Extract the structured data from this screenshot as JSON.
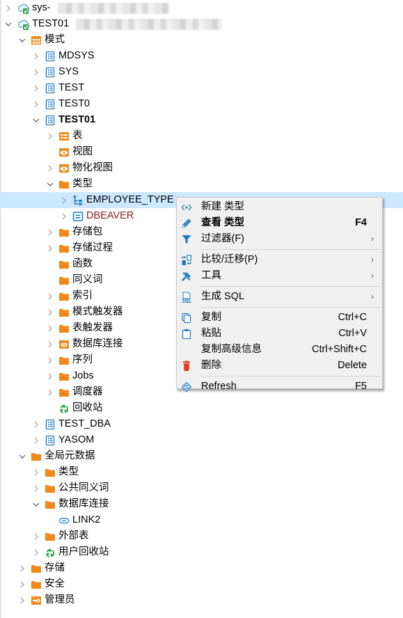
{
  "tree": {
    "rows": [
      {
        "label": "sys",
        "suffix": " -",
        "redacted": true,
        "indent": 0,
        "twisty": "collapsed",
        "icon": "db-connection-icon"
      },
      {
        "label": "TEST01",
        "redacted": true,
        "indent": 0,
        "twisty": "expanded",
        "icon": "db-connection-icon"
      },
      {
        "label": "模式",
        "indent": 1,
        "twisty": "expanded",
        "icon": "schema-folder-icon"
      },
      {
        "label": "MDSYS",
        "indent": 2,
        "twisty": "collapsed",
        "icon": "schema-icon"
      },
      {
        "label": "SYS",
        "indent": 2,
        "twisty": "collapsed",
        "icon": "schema-icon"
      },
      {
        "label": "TEST",
        "indent": 2,
        "twisty": "collapsed",
        "icon": "schema-icon"
      },
      {
        "label": "TEST0",
        "indent": 2,
        "twisty": "collapsed",
        "icon": "schema-icon"
      },
      {
        "label": "TEST01",
        "indent": 2,
        "twisty": "expanded",
        "icon": "schema-icon",
        "bold": true
      },
      {
        "label": "表",
        "indent": 3,
        "twisty": "collapsed",
        "icon": "table-folder-icon"
      },
      {
        "label": "视图",
        "indent": 3,
        "twisty": "none",
        "icon": "view-folder-icon"
      },
      {
        "label": "物化视图",
        "indent": 3,
        "twisty": "collapsed",
        "icon": "view-folder-icon"
      },
      {
        "label": "类型",
        "indent": 3,
        "twisty": "expanded",
        "icon": "folder-icon"
      },
      {
        "label": "EMPLOYEE_TYPE",
        "indent": 4,
        "twisty": "collapsed",
        "icon": "type-icon",
        "selected": true
      },
      {
        "label": "DBEAVER",
        "indent": 4,
        "twisty": "collapsed",
        "icon": "type-invalid-icon",
        "red": true
      },
      {
        "label": "存储包",
        "indent": 3,
        "twisty": "collapsed",
        "icon": "folder-icon"
      },
      {
        "label": "存储过程",
        "indent": 3,
        "twisty": "collapsed",
        "icon": "folder-icon"
      },
      {
        "label": "函数",
        "indent": 3,
        "twisty": "none",
        "icon": "folder-icon"
      },
      {
        "label": "同义词",
        "indent": 3,
        "twisty": "none",
        "icon": "folder-icon"
      },
      {
        "label": "索引",
        "indent": 3,
        "twisty": "collapsed",
        "icon": "folder-icon"
      },
      {
        "label": "模式触发器",
        "indent": 3,
        "twisty": "collapsed",
        "icon": "folder-icon"
      },
      {
        "label": "表触发器",
        "indent": 3,
        "twisty": "collapsed",
        "icon": "folder-icon"
      },
      {
        "label": "数据库连接",
        "indent": 3,
        "twisty": "collapsed",
        "icon": "link-folder-icon"
      },
      {
        "label": "序列",
        "indent": 3,
        "twisty": "collapsed",
        "icon": "folder-icon"
      },
      {
        "label": "Jobs",
        "indent": 3,
        "twisty": "collapsed",
        "icon": "folder-icon"
      },
      {
        "label": "调度器",
        "indent": 3,
        "twisty": "collapsed",
        "icon": "folder-icon"
      },
      {
        "label": "回收站",
        "indent": 3,
        "twisty": "none",
        "icon": "recycle-icon"
      },
      {
        "label": "TEST_DBA",
        "indent": 2,
        "twisty": "collapsed",
        "icon": "schema-icon"
      },
      {
        "label": "YASOM",
        "indent": 2,
        "twisty": "collapsed",
        "icon": "schema-icon"
      },
      {
        "label": "全局元数据",
        "indent": 1,
        "twisty": "expanded",
        "icon": "folder-icon"
      },
      {
        "label": "类型",
        "indent": 2,
        "twisty": "collapsed",
        "icon": "folder-icon"
      },
      {
        "label": "公共同义词",
        "indent": 2,
        "twisty": "collapsed",
        "icon": "folder-icon"
      },
      {
        "label": "数据库连接",
        "indent": 2,
        "twisty": "expanded",
        "icon": "folder-icon"
      },
      {
        "label": "LINK2",
        "indent": 3,
        "twisty": "none",
        "icon": "link-icon"
      },
      {
        "label": "外部表",
        "indent": 2,
        "twisty": "collapsed",
        "icon": "folder-icon"
      },
      {
        "label": "用户回收站",
        "indent": 2,
        "twisty": "collapsed",
        "icon": "recycle-icon"
      },
      {
        "label": "存储",
        "indent": 1,
        "twisty": "collapsed",
        "icon": "folder-icon"
      },
      {
        "label": "安全",
        "indent": 1,
        "twisty": "collapsed",
        "icon": "folder-icon"
      },
      {
        "label": "管理员",
        "indent": 1,
        "twisty": "collapsed",
        "icon": "admin-folder-icon"
      }
    ]
  },
  "context_menu": {
    "items": [
      {
        "type": "item",
        "label": "新建 类型",
        "icon": "new-icon",
        "accel": "",
        "submenu": false
      },
      {
        "type": "item",
        "label": "查看 类型",
        "icon": "edit-pencil-icon",
        "accel": "F4",
        "bold": true,
        "submenu": false
      },
      {
        "type": "item",
        "label": "过滤器(F)",
        "icon": "filter-icon",
        "accel": "",
        "submenu": true
      },
      {
        "type": "separator"
      },
      {
        "type": "item",
        "label": "比较/迁移(P)",
        "icon": "compare-icon",
        "accel": "",
        "submenu": true
      },
      {
        "type": "item",
        "label": "工具",
        "icon": "tools-icon",
        "accel": "",
        "submenu": true
      },
      {
        "type": "separator"
      },
      {
        "type": "item",
        "label": "生成 SQL",
        "icon": "sql-icon",
        "accel": "",
        "submenu": true
      },
      {
        "type": "separator"
      },
      {
        "type": "item",
        "label": "复制",
        "icon": "copy-icon",
        "accel": "Ctrl+C",
        "submenu": false
      },
      {
        "type": "item",
        "label": "粘贴",
        "icon": "paste-icon",
        "accel": "Ctrl+V",
        "submenu": false
      },
      {
        "type": "item",
        "label": "复制高级信息",
        "icon": "",
        "accel": "Ctrl+Shift+C",
        "submenu": false
      },
      {
        "type": "item",
        "label": "删除",
        "icon": "delete-icon",
        "accel": "Delete",
        "submenu": false
      },
      {
        "type": "separator"
      },
      {
        "type": "item",
        "label": "Refresh",
        "icon": "refresh-icon",
        "accel": "F5",
        "submenu": false
      }
    ],
    "submenu_glyph": "›"
  },
  "colors": {
    "selection": "#cce8ff",
    "folder": "#f0891a",
    "schema_blue": "#1a7fc4",
    "invalid_red": "#8b1a1a",
    "recycle_green": "#2da84a",
    "delete_red": "#e8321e",
    "menu_bg": "#f0f0f0"
  }
}
